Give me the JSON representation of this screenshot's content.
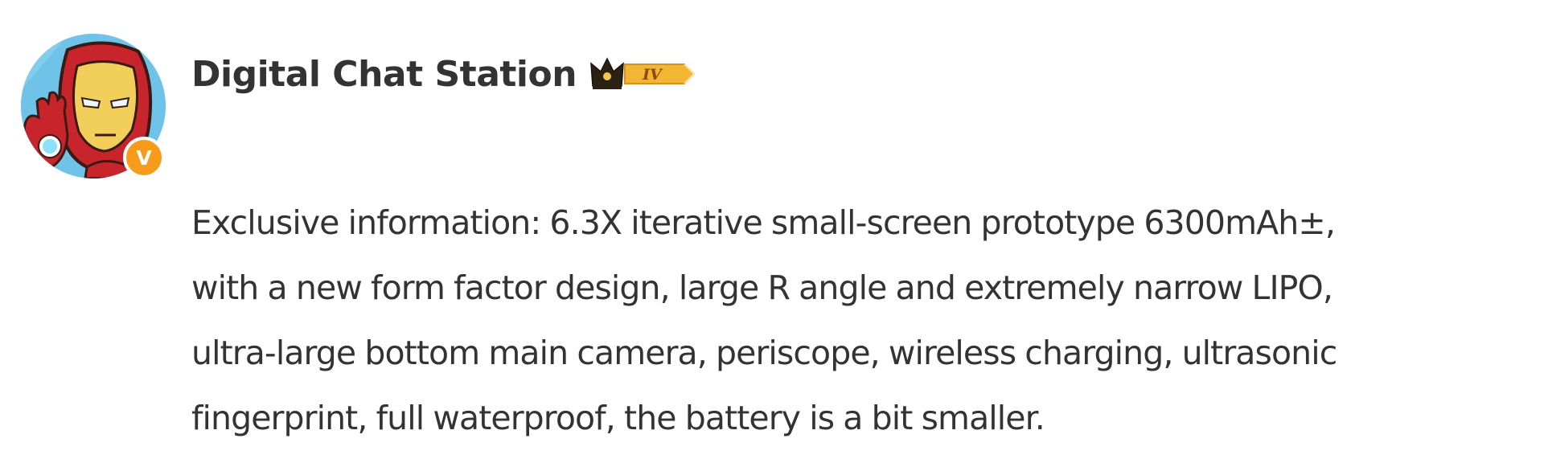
{
  "post": {
    "author": {
      "name": "Digital Chat Station",
      "verified_mark": "V",
      "vip_level": "IV"
    },
    "text_lines": [
      "Exclusive information: 6.3X iterative small-screen prototype 6300mAh±,",
      "with a new form factor design, large R angle and extremely narrow LIPO,",
      "ultra-large bottom main camera, periscope, wireless charging, ultrasonic",
      "fingerprint, full waterproof, the battery is a bit smaller."
    ]
  },
  "colors": {
    "text": "#333333",
    "verified_badge": "#f79b1b",
    "vip_badge": "#f3b534",
    "avatar_background": "#6fc3e8"
  },
  "icons": {
    "avatar": "iron-man-cartoon-avatar",
    "verified": "verified-v-badge-icon",
    "vip": "crown-icon"
  }
}
